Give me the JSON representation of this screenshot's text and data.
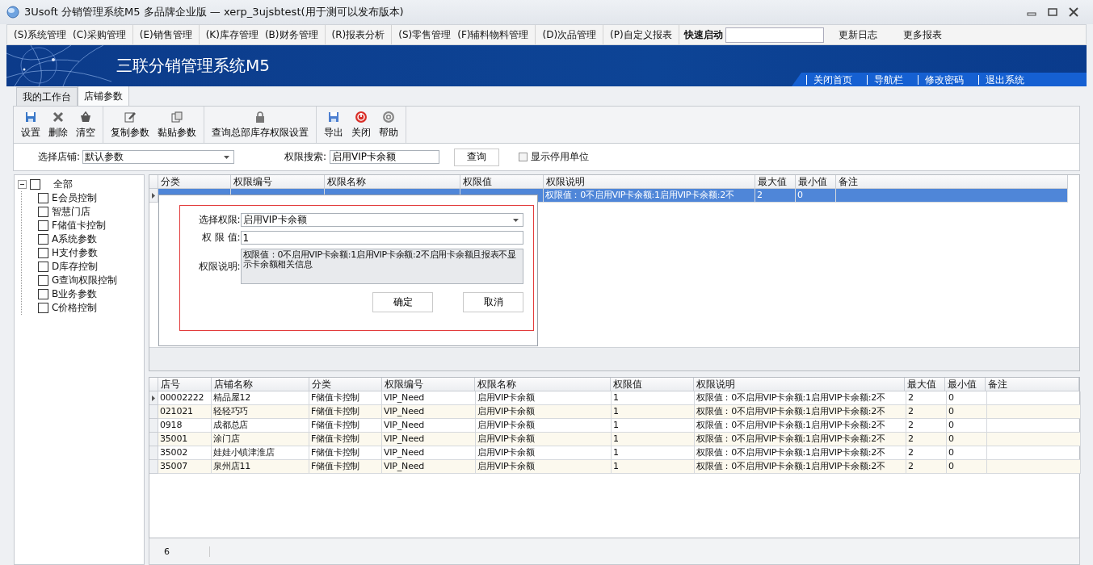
{
  "window": {
    "title": "3Usoft 分销管理系统M5 多品牌企业版 — xerp_3ujsbtest(用于测可以发布版本)"
  },
  "menu": {
    "groups": [
      [
        "(S)系统管理",
        "(C)采购管理"
      ],
      [
        "(E)销售管理"
      ],
      [
        "(K)库存管理",
        "(B)财务管理"
      ],
      [
        "(R)报表分析"
      ],
      [
        "(S)零售管理",
        "(F)辅料物料管理"
      ],
      [
        "(D)次品管理"
      ],
      [
        "(P)自定义报表"
      ]
    ],
    "quick_start_label": "快速启动",
    "links": [
      "更新日志",
      "更多报表"
    ]
  },
  "banner": {
    "title": "三联分销管理系统M5",
    "links": [
      "关闭首页",
      "导航栏",
      "修改密码",
      "退出系统"
    ]
  },
  "tabs": [
    {
      "label": "我的工作台",
      "selected": false
    },
    {
      "label": "店铺参数",
      "selected": true
    }
  ],
  "toolbar": [
    [
      "设置",
      "删除",
      "清空"
    ],
    [
      "复制参数",
      "黏贴参数"
    ],
    [
      "查询总部库存权限设置"
    ],
    [
      "导出",
      "关闭",
      "帮助"
    ]
  ],
  "filter": {
    "store_label": "选择店铺:",
    "store_value": "默认参数",
    "search_label": "权限搜索:",
    "search_value": "启用VIP卡余额",
    "query_button": "查询",
    "show_disabled": {
      "label": "显示停用单位",
      "checked": false
    }
  },
  "tree": {
    "label": "全部",
    "expanded": true,
    "checked": false,
    "children": [
      {
        "label": "E会员控制",
        "checked": false
      },
      {
        "label": "智慧门店",
        "checked": false
      },
      {
        "label": "F储值卡控制",
        "checked": false
      },
      {
        "label": "A系统参数",
        "checked": false
      },
      {
        "label": "H支付参数",
        "checked": false
      },
      {
        "label": "D库存控制",
        "checked": false
      },
      {
        "label": "G查询权限控制",
        "checked": false
      },
      {
        "label": "B业务参数",
        "checked": false
      },
      {
        "label": "C价格控制",
        "checked": false
      }
    ]
  },
  "top_grid": {
    "columns": [
      "分类",
      "权限编号",
      "权限名称",
      "权限值",
      "权限说明",
      "最大值",
      "最小值",
      "备注"
    ],
    "rows": [
      {
        "selected": true,
        "current": true,
        "description": "权限值：0不启用VIP卡余额:1启用VIP卡余额:2不",
        "max_value": "2",
        "min_value": "0"
      }
    ]
  },
  "dialog": {
    "permission_label": "选择权限:",
    "permission_value": "启用VIP卡余额",
    "value_label": "权 限 值:",
    "value": "1",
    "description_label": "权限说明:",
    "description": "权限值：0不启用VIP卡余额:1启用VIP卡余额:2不启用卡余额且报表不显示卡余额相关信息",
    "buttons": [
      "确定",
      "取消"
    ]
  },
  "bottom_grid": {
    "columns": [
      "店号",
      "店铺名称",
      "分类",
      "权限编号",
      "权限名称",
      "权限值",
      "权限说明",
      "最大值",
      "最小值",
      "备注"
    ],
    "rows": [
      {
        "current": true,
        "cells": [
          "00002222",
          "精品屋12",
          "F储值卡控制",
          "VIP_Need",
          "启用VIP卡余额",
          "1",
          "权限值：0不启用VIP卡余额:1启用VIP卡余额:2不",
          "2",
          "0"
        ]
      },
      {
        "current": false,
        "cells": [
          "021021",
          "轻轻巧巧",
          "F储值卡控制",
          "VIP_Need",
          "启用VIP卡余额",
          "1",
          "权限值：0不启用VIP卡余额:1启用VIP卡余额:2不",
          "2",
          "0"
        ]
      },
      {
        "current": false,
        "cells": [
          "0918",
          "成都总店",
          "F储值卡控制",
          "VIP_Need",
          "启用VIP卡余额",
          "1",
          "权限值：0不启用VIP卡余额:1启用VIP卡余额:2不",
          "2",
          "0"
        ]
      },
      {
        "current": false,
        "cells": [
          "35001",
          "涂门店",
          "F储值卡控制",
          "VIP_Need",
          "启用VIP卡余额",
          "1",
          "权限值：0不启用VIP卡余额:1启用VIP卡余额:2不",
          "2",
          "0"
        ]
      },
      {
        "current": false,
        "cells": [
          "35002",
          "娃娃小镇津淮店",
          "F储值卡控制",
          "VIP_Need",
          "启用VIP卡余额",
          "1",
          "权限值：0不启用VIP卡余额:1启用VIP卡余额:2不",
          "2",
          "0"
        ]
      },
      {
        "current": false,
        "cells": [
          "35007",
          "泉州店11",
          "F储值卡控制",
          "VIP_Need",
          "启用VIP卡余额",
          "1",
          "权限值：0不启用VIP卡余额:1启用VIP卡余额:2不",
          "2",
          "0"
        ]
      }
    ]
  },
  "status_bar": {
    "count": "6"
  }
}
